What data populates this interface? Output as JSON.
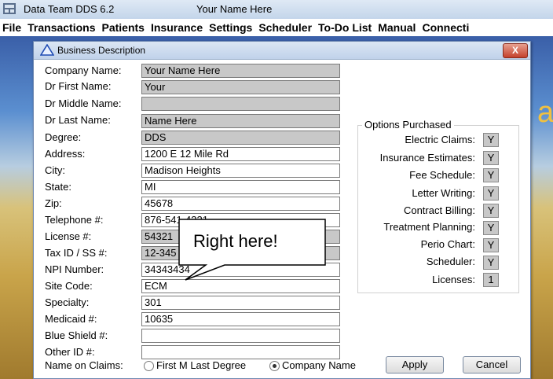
{
  "window": {
    "app_title": "Data Team DDS 6.2",
    "doc_title": "Your Name Here"
  },
  "menu": [
    "File",
    "Transactions",
    "Patients",
    "Insurance",
    "Settings",
    "Scheduler",
    "To-Do List",
    "Manual",
    "Connecti"
  ],
  "dialog": {
    "title": "Business Description",
    "close": "X",
    "fields": [
      {
        "label": "Company Name:",
        "value": "Your Name Here"
      },
      {
        "label": "Dr First Name:",
        "value": "Your"
      },
      {
        "label": "Dr Middle Name:",
        "value": ""
      },
      {
        "label": "Dr Last Name:",
        "value": "Name Here"
      },
      {
        "label": "Degree:",
        "value": "DDS"
      },
      {
        "label": "Address:",
        "value": "1200 E 12 Mile Rd"
      },
      {
        "label": "City:",
        "value": "Madison Heights"
      },
      {
        "label": "State:",
        "value": "MI"
      },
      {
        "label": "Zip:",
        "value": "45678"
      },
      {
        "label": "Telephone #:",
        "value": "876-541-4321"
      },
      {
        "label": "License #:",
        "value": "54321"
      },
      {
        "label": "Tax ID / SS #:",
        "value": "12-345"
      },
      {
        "label": "NPI Number:",
        "value": "34343434"
      },
      {
        "label": "Site Code:",
        "value": "ECM"
      },
      {
        "label": "Specialty:",
        "value": "301"
      },
      {
        "label": "Medicaid #:",
        "value": "10635"
      },
      {
        "label": "Blue Shield #:",
        "value": ""
      },
      {
        "label": "Other ID #:",
        "value": ""
      }
    ],
    "options_title": "Options Purchased",
    "options": [
      {
        "label": "Electric Claims:",
        "value": "Y"
      },
      {
        "label": "Insurance Estimates:",
        "value": "Y"
      },
      {
        "label": "Fee Schedule:",
        "value": "Y"
      },
      {
        "label": "Letter Writing:",
        "value": "Y"
      },
      {
        "label": "Contract Billing:",
        "value": "Y"
      },
      {
        "label": "Treatment Planning:",
        "value": "Y"
      },
      {
        "label": "Perio Chart:",
        "value": "Y"
      },
      {
        "label": "Scheduler:",
        "value": "Y"
      },
      {
        "label": "Licenses:",
        "value": "1"
      }
    ],
    "name_on_claims_label": "Name on Claims:",
    "radio_first": "First M Last Degree",
    "radio_company": "Company Name",
    "apply": "Apply",
    "cancel": "Cancel"
  },
  "callout": {
    "text": "Right here!"
  },
  "background_text": "a"
}
